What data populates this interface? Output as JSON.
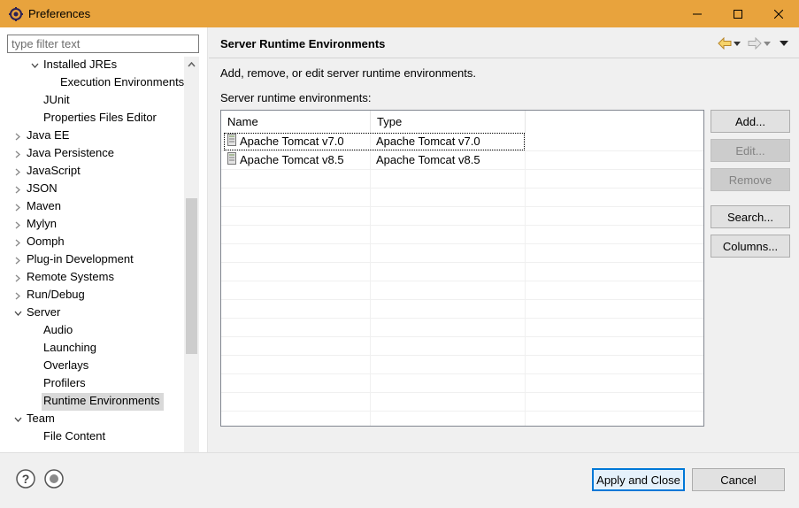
{
  "window": {
    "title": "Preferences",
    "minimize": "—",
    "maximize": "☐",
    "close": "✕"
  },
  "filter": {
    "placeholder": "type filter text"
  },
  "tree": [
    {
      "label": "Installed JREs",
      "state": "expanded"
    },
    {
      "label": "Execution Environments",
      "state": "leaf"
    },
    {
      "label": "JUnit",
      "state": "leaf"
    },
    {
      "label": "Properties Files Editor",
      "state": "leaf"
    },
    {
      "label": "Java EE",
      "state": "collapsed"
    },
    {
      "label": "Java Persistence",
      "state": "collapsed"
    },
    {
      "label": "JavaScript",
      "state": "collapsed"
    },
    {
      "label": "JSON",
      "state": "collapsed"
    },
    {
      "label": "Maven",
      "state": "collapsed"
    },
    {
      "label": "Mylyn",
      "state": "collapsed"
    },
    {
      "label": "Oomph",
      "state": "collapsed"
    },
    {
      "label": "Plug-in Development",
      "state": "collapsed"
    },
    {
      "label": "Remote Systems",
      "state": "collapsed"
    },
    {
      "label": "Run/Debug",
      "state": "collapsed"
    },
    {
      "label": "Server",
      "state": "expanded"
    },
    {
      "label": "Audio",
      "state": "leaf"
    },
    {
      "label": "Launching",
      "state": "leaf"
    },
    {
      "label": "Overlays",
      "state": "leaf"
    },
    {
      "label": "Profilers",
      "state": "leaf"
    },
    {
      "label": "Runtime Environments",
      "state": "leaf",
      "selected": true
    },
    {
      "label": "Team",
      "state": "expanded"
    },
    {
      "label": "File Content",
      "state": "leaf"
    }
  ],
  "page": {
    "title": "Server Runtime Environments",
    "description": "Add, remove, or edit server runtime environments.",
    "list_label": "Server runtime environments:"
  },
  "table": {
    "columns": [
      "Name",
      "Type"
    ],
    "rows": [
      {
        "name": "Apache Tomcat v7.0",
        "type": "Apache Tomcat v7.0"
      },
      {
        "name": "Apache Tomcat v8.5",
        "type": "Apache Tomcat v8.5"
      }
    ]
  },
  "buttons": {
    "add": "Add...",
    "edit": "Edit...",
    "remove": "Remove",
    "search": "Search...",
    "columns": "Columns..."
  },
  "footer": {
    "apply_close": "Apply and Close",
    "cancel": "Cancel"
  },
  "colors": {
    "titlebar": "#e8a33d",
    "selection": "#d9d9d9",
    "primary_border": "#0078d7"
  }
}
